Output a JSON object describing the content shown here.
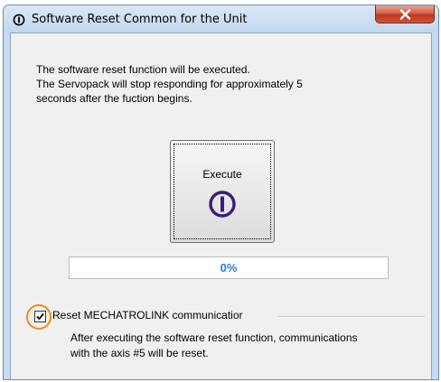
{
  "window": {
    "title": "Software Reset Common for the Unit",
    "close_label": "Close"
  },
  "description": {
    "lines": [
      "The software reset function will be executed.",
      "The Servopack will stop responding for approximately 5",
      "seconds after the fuction begins."
    ]
  },
  "execute_button": {
    "label": "Execute",
    "icon": "power-icon"
  },
  "progress": {
    "value": 0,
    "text": "0%"
  },
  "reset_option": {
    "label": "Reset MECHATROLINK communicatior",
    "checked": true,
    "lines": [
      "After executing the software reset function, communications",
      "with the axis #5 will be reset."
    ]
  },
  "colors": {
    "window_frame": "#c6dbef",
    "accent_purple": "#3a1d7a",
    "progress_text": "#2a7fd4",
    "highlight_orange": "#f08a1e",
    "close_red": "#c0391f"
  }
}
